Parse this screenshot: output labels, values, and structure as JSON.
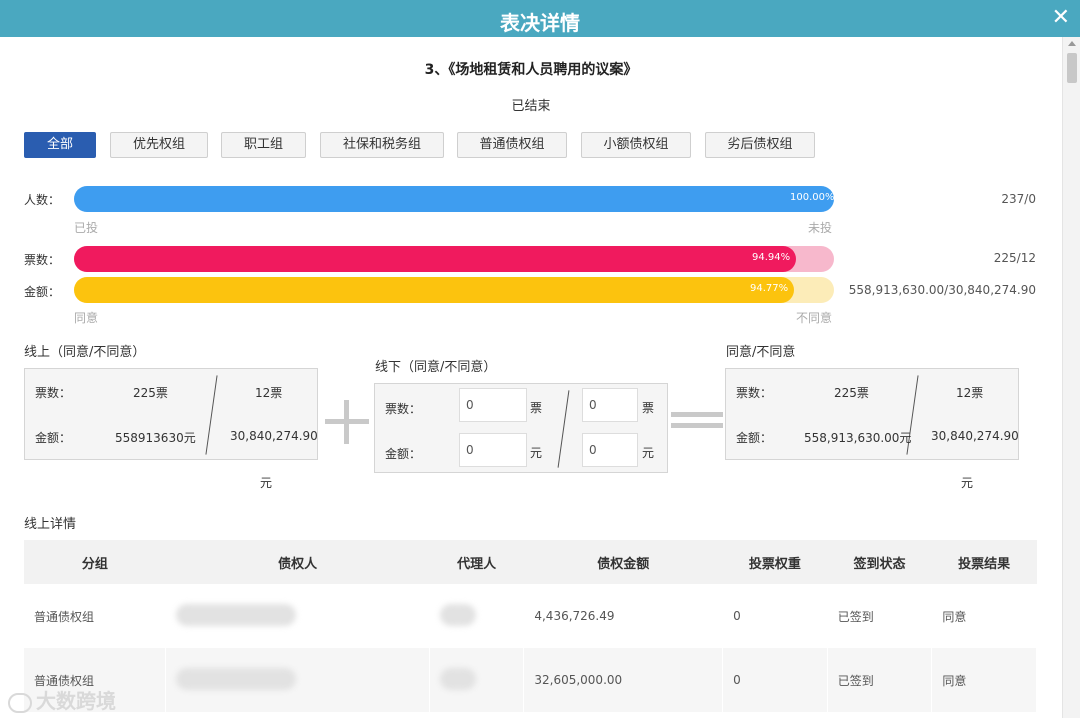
{
  "dialog": {
    "title": "表决详情",
    "close_icon": "close-icon"
  },
  "motion": {
    "title": "3、《场地租赁和人员聘用的议案》",
    "status": "已结束"
  },
  "tabs": [
    "全部",
    "优先权组",
    "职工组",
    "社保和税务组",
    "普通债权组",
    "小额债权组",
    "劣后债权组"
  ],
  "active_tab": 0,
  "bars": {
    "people": {
      "label": "人数：",
      "pct_text": "100.00%",
      "fraction": 1.0,
      "right": "237/0",
      "left_caption": "已投",
      "right_caption": "未投",
      "color": "#3e9df0",
      "track": "#dbe9f8"
    },
    "votes": {
      "label": "票数：",
      "pct_text": "94.94%",
      "fraction": 0.9494,
      "right": "225/12",
      "color": "#f01a5e",
      "track": "#f7b8cc"
    },
    "amount": {
      "label": "金额：",
      "pct_text": "94.77%",
      "fraction": 0.9477,
      "right": "558,913,630.00/30,840,274.90",
      "left_caption": "同意",
      "right_caption": "不同意",
      "color": "#fcc30e",
      "track": "#fcecb8"
    }
  },
  "online": {
    "title": "线上（同意/不同意）",
    "votes_label": "票数：",
    "votes_agree": "225票",
    "votes_disagree": "12票",
    "amount_label": "金额：",
    "amount_agree": "558913630元",
    "amount_disagree": "30,840,274.90",
    "trailing_unit": "元"
  },
  "offline": {
    "title": "线下（同意/不同意）",
    "votes_label": "票数：",
    "votes_agree": "0",
    "votes_disagree": "0",
    "votes_unit": "票",
    "amount_label": "金额：",
    "amount_agree": "0",
    "amount_disagree": "0",
    "amount_unit": "元"
  },
  "total": {
    "title": "同意/不同意",
    "votes_label": "票数：",
    "votes_agree": "225票",
    "votes_disagree": "12票",
    "amount_label": "金额：",
    "amount_agree": "558,913,630.00元",
    "amount_disagree": "30,840,274.90",
    "trailing_unit": "元"
  },
  "detail": {
    "title": "线上详情",
    "headers": [
      "分组",
      "债权人",
      "代理人",
      "债权金额",
      "投票权重",
      "签到状态",
      "投票结果"
    ],
    "rows": [
      {
        "group": "普通债权组",
        "amount": "4,436,726.49",
        "weight": "0",
        "signin": "已签到",
        "result": "同意"
      },
      {
        "group": "普通债权组",
        "amount": "32,605,000.00",
        "weight": "0",
        "signin": "已签到",
        "result": "同意"
      }
    ]
  },
  "watermark": "大数跨境"
}
